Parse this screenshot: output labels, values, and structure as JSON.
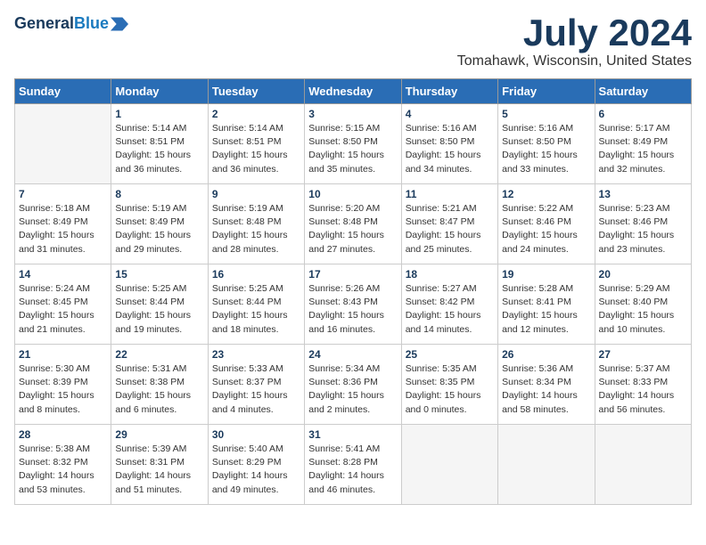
{
  "header": {
    "logo_general": "General",
    "logo_blue": "Blue",
    "month_title": "July 2024",
    "location": "Tomahawk, Wisconsin, United States"
  },
  "calendar": {
    "days_of_week": [
      "Sunday",
      "Monday",
      "Tuesday",
      "Wednesday",
      "Thursday",
      "Friday",
      "Saturday"
    ],
    "weeks": [
      [
        {
          "day": "",
          "info": ""
        },
        {
          "day": "1",
          "info": "Sunrise: 5:14 AM\nSunset: 8:51 PM\nDaylight: 15 hours\nand 36 minutes."
        },
        {
          "day": "2",
          "info": "Sunrise: 5:14 AM\nSunset: 8:51 PM\nDaylight: 15 hours\nand 36 minutes."
        },
        {
          "day": "3",
          "info": "Sunrise: 5:15 AM\nSunset: 8:50 PM\nDaylight: 15 hours\nand 35 minutes."
        },
        {
          "day": "4",
          "info": "Sunrise: 5:16 AM\nSunset: 8:50 PM\nDaylight: 15 hours\nand 34 minutes."
        },
        {
          "day": "5",
          "info": "Sunrise: 5:16 AM\nSunset: 8:50 PM\nDaylight: 15 hours\nand 33 minutes."
        },
        {
          "day": "6",
          "info": "Sunrise: 5:17 AM\nSunset: 8:49 PM\nDaylight: 15 hours\nand 32 minutes."
        }
      ],
      [
        {
          "day": "7",
          "info": "Sunrise: 5:18 AM\nSunset: 8:49 PM\nDaylight: 15 hours\nand 31 minutes."
        },
        {
          "day": "8",
          "info": "Sunrise: 5:19 AM\nSunset: 8:49 PM\nDaylight: 15 hours\nand 29 minutes."
        },
        {
          "day": "9",
          "info": "Sunrise: 5:19 AM\nSunset: 8:48 PM\nDaylight: 15 hours\nand 28 minutes."
        },
        {
          "day": "10",
          "info": "Sunrise: 5:20 AM\nSunset: 8:48 PM\nDaylight: 15 hours\nand 27 minutes."
        },
        {
          "day": "11",
          "info": "Sunrise: 5:21 AM\nSunset: 8:47 PM\nDaylight: 15 hours\nand 25 minutes."
        },
        {
          "day": "12",
          "info": "Sunrise: 5:22 AM\nSunset: 8:46 PM\nDaylight: 15 hours\nand 24 minutes."
        },
        {
          "day": "13",
          "info": "Sunrise: 5:23 AM\nSunset: 8:46 PM\nDaylight: 15 hours\nand 23 minutes."
        }
      ],
      [
        {
          "day": "14",
          "info": "Sunrise: 5:24 AM\nSunset: 8:45 PM\nDaylight: 15 hours\nand 21 minutes."
        },
        {
          "day": "15",
          "info": "Sunrise: 5:25 AM\nSunset: 8:44 PM\nDaylight: 15 hours\nand 19 minutes."
        },
        {
          "day": "16",
          "info": "Sunrise: 5:25 AM\nSunset: 8:44 PM\nDaylight: 15 hours\nand 18 minutes."
        },
        {
          "day": "17",
          "info": "Sunrise: 5:26 AM\nSunset: 8:43 PM\nDaylight: 15 hours\nand 16 minutes."
        },
        {
          "day": "18",
          "info": "Sunrise: 5:27 AM\nSunset: 8:42 PM\nDaylight: 15 hours\nand 14 minutes."
        },
        {
          "day": "19",
          "info": "Sunrise: 5:28 AM\nSunset: 8:41 PM\nDaylight: 15 hours\nand 12 minutes."
        },
        {
          "day": "20",
          "info": "Sunrise: 5:29 AM\nSunset: 8:40 PM\nDaylight: 15 hours\nand 10 minutes."
        }
      ],
      [
        {
          "day": "21",
          "info": "Sunrise: 5:30 AM\nSunset: 8:39 PM\nDaylight: 15 hours\nand 8 minutes."
        },
        {
          "day": "22",
          "info": "Sunrise: 5:31 AM\nSunset: 8:38 PM\nDaylight: 15 hours\nand 6 minutes."
        },
        {
          "day": "23",
          "info": "Sunrise: 5:33 AM\nSunset: 8:37 PM\nDaylight: 15 hours\nand 4 minutes."
        },
        {
          "day": "24",
          "info": "Sunrise: 5:34 AM\nSunset: 8:36 PM\nDaylight: 15 hours\nand 2 minutes."
        },
        {
          "day": "25",
          "info": "Sunrise: 5:35 AM\nSunset: 8:35 PM\nDaylight: 15 hours\nand 0 minutes."
        },
        {
          "day": "26",
          "info": "Sunrise: 5:36 AM\nSunset: 8:34 PM\nDaylight: 14 hours\nand 58 minutes."
        },
        {
          "day": "27",
          "info": "Sunrise: 5:37 AM\nSunset: 8:33 PM\nDaylight: 14 hours\nand 56 minutes."
        }
      ],
      [
        {
          "day": "28",
          "info": "Sunrise: 5:38 AM\nSunset: 8:32 PM\nDaylight: 14 hours\nand 53 minutes."
        },
        {
          "day": "29",
          "info": "Sunrise: 5:39 AM\nSunset: 8:31 PM\nDaylight: 14 hours\nand 51 minutes."
        },
        {
          "day": "30",
          "info": "Sunrise: 5:40 AM\nSunset: 8:29 PM\nDaylight: 14 hours\nand 49 minutes."
        },
        {
          "day": "31",
          "info": "Sunrise: 5:41 AM\nSunset: 8:28 PM\nDaylight: 14 hours\nand 46 minutes."
        },
        {
          "day": "",
          "info": ""
        },
        {
          "day": "",
          "info": ""
        },
        {
          "day": "",
          "info": ""
        }
      ]
    ]
  }
}
